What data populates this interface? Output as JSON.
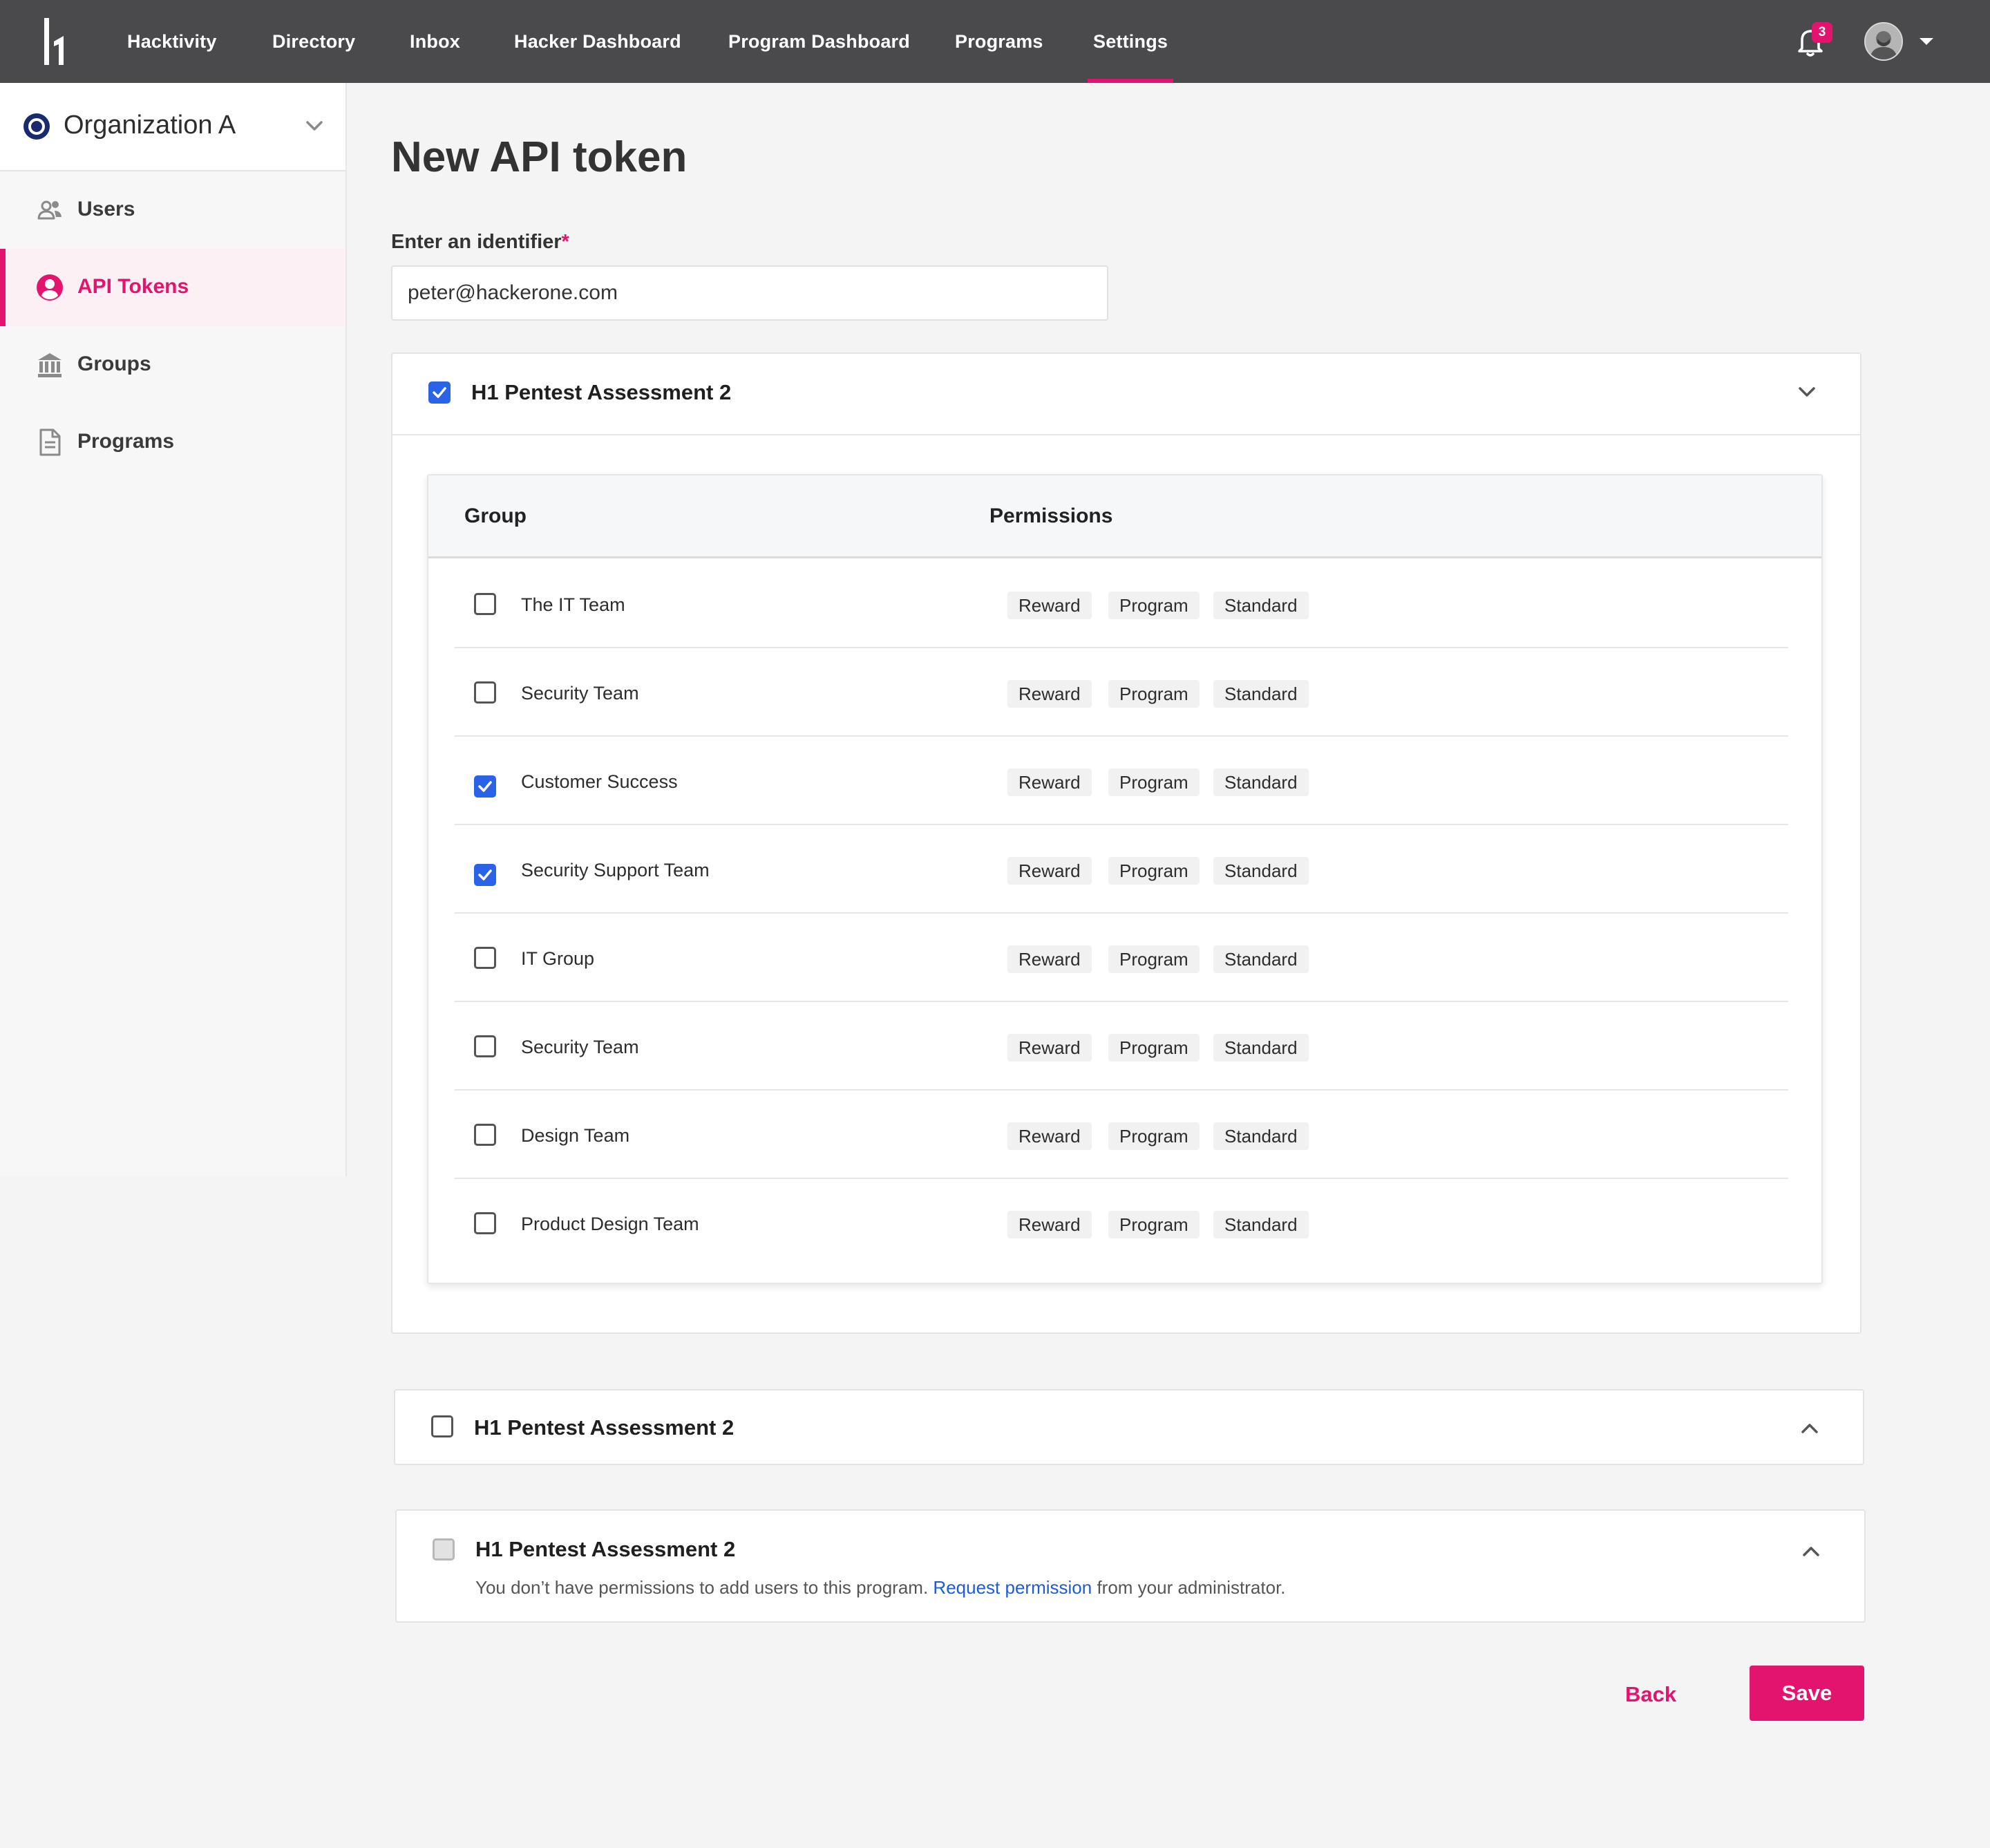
{
  "nav": {
    "items": [
      "Hacktivity",
      "Directory",
      "Inbox",
      "Hacker Dashboard",
      "Program Dashboard",
      "Programs",
      "Settings"
    ],
    "active": "Settings",
    "notification_count": "3",
    "logo_icon": "hackerone-logo",
    "bell_icon": "bell-icon",
    "avatar_icon": "avatar"
  },
  "sidebar": {
    "org_name": "Organization A",
    "items": [
      {
        "label": "Users",
        "icon": "users-icon"
      },
      {
        "label": "API Tokens",
        "icon": "user-circle-icon",
        "active": true
      },
      {
        "label": "Groups",
        "icon": "bank-icon"
      },
      {
        "label": "Programs",
        "icon": "document-icon"
      }
    ]
  },
  "main": {
    "title": "New API token",
    "identifier_label": "Enter an identifier",
    "required_mark": "*",
    "identifier_value": "peter@hackerone.com",
    "programs": [
      {
        "title": "H1 Pentest Assessment 2",
        "checked": true,
        "expanded": true,
        "table": {
          "headers": [
            "Group",
            "Permissions"
          ],
          "rows": [
            {
              "group": "The IT Team",
              "checked": false,
              "permissions": [
                "Reward",
                "Program",
                "Standard"
              ]
            },
            {
              "group": "Security Team",
              "checked": false,
              "permissions": [
                "Reward",
                "Program",
                "Standard"
              ]
            },
            {
              "group": "Customer Success",
              "checked": true,
              "permissions": [
                "Reward",
                "Program",
                "Standard"
              ]
            },
            {
              "group": "Security Support Team",
              "checked": true,
              "permissions": [
                "Reward",
                "Program",
                "Standard"
              ]
            },
            {
              "group": "IT Group",
              "checked": false,
              "permissions": [
                "Reward",
                "Program",
                "Standard"
              ]
            },
            {
              "group": "Security Team",
              "checked": false,
              "permissions": [
                "Reward",
                "Program",
                "Standard"
              ]
            },
            {
              "group": "Design Team",
              "checked": false,
              "permissions": [
                "Reward",
                "Program",
                "Standard"
              ]
            },
            {
              "group": "Product Design Team",
              "checked": false,
              "permissions": [
                "Reward",
                "Program",
                "Standard"
              ]
            }
          ]
        }
      },
      {
        "title": "H1 Pentest Assessment 2",
        "checked": false,
        "expanded": false
      },
      {
        "title": "H1 Pentest Assessment 2",
        "checked": false,
        "disabled": true,
        "note_before": "You don’t have permissions to add users to this program.",
        "note_link": "Request permission",
        "note_after": "from your administrator."
      }
    ],
    "back_label": "Back",
    "save_label": "Save"
  },
  "colors": {
    "brand": "#e2146e",
    "nav_bg": "#4a4a4c",
    "checkbox_checked": "#2a62e8",
    "link": "#1f5bd6"
  }
}
